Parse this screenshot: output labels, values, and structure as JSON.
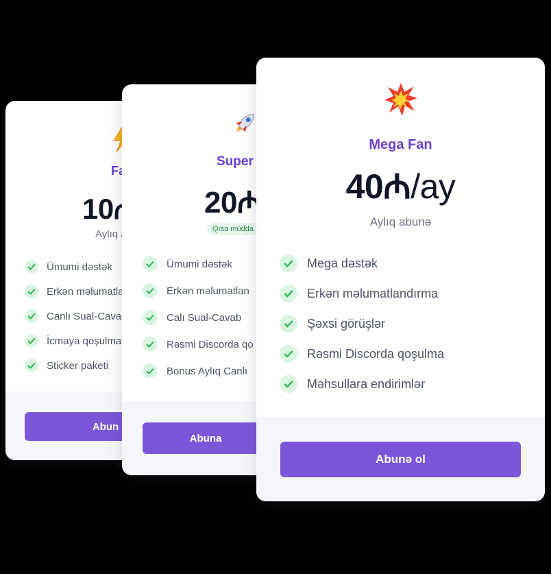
{
  "colors": {
    "accent": "#7c56d9",
    "plan_name": "#6a3fd0",
    "check_bg": "#d9f5e2",
    "check": "#2fb45a",
    "badge_bg": "#e5f7ea",
    "badge_text": "#2e8a4a",
    "background": "#000000"
  },
  "cards": {
    "fan": {
      "icon": "lightning-icon",
      "name": "Fa",
      "price": "10",
      "currency": "₼",
      "period": "Aylıq a",
      "features": [
        "Ümumi dəstək",
        "Erkən məlumatlan",
        "Canlı Sual-Cavab",
        "İcmaya qoşulma",
        "Sticker paketi"
      ],
      "button": "Abun"
    },
    "super": {
      "icon": "rocket-icon",
      "name": "Super",
      "price": "20",
      "currency": "₼",
      "badge": "Qısa müdda",
      "features": [
        "Ümumi dəstək",
        "Erkən məlumatlan",
        "Calı Sual-Cavab",
        "Rəsmi Discorda qo",
        "Bonus Aylıq Canlı"
      ],
      "button": "Abuna"
    },
    "mega": {
      "icon": "collision-icon",
      "name": "Mega Fan",
      "price": "40",
      "currency": "₼",
      "per": "/ay",
      "period": "Aylıq abunə",
      "features": [
        "Mega dəstək",
        "Erkən məlumatlandırma",
        "Şəxsi görüşlər",
        "Rəsmi Discorda qoşulma",
        "Məhsullara endirimlər"
      ],
      "button": "Abunə ol"
    }
  }
}
